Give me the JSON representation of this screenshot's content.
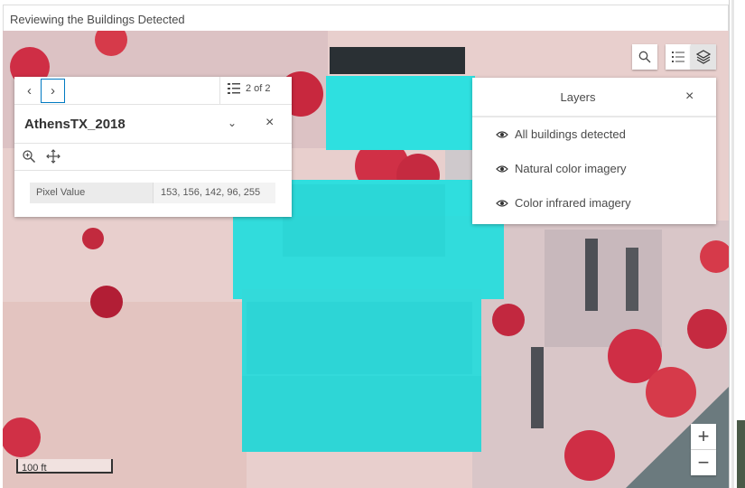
{
  "app": {
    "title": "Reviewing the Buildings Detected"
  },
  "popup": {
    "pagination": "2 of 2",
    "title": "AthensTX_2018",
    "fields": [
      {
        "label": "Pixel Value",
        "value": "153, 156, 142, 96, 255"
      }
    ],
    "icons": [
      "chevron-left-icon",
      "chevron-right-icon",
      "list-icon",
      "chevron-down-icon",
      "close-icon",
      "zoom-to-icon",
      "move-icon"
    ]
  },
  "toolbar": {
    "icons": [
      "search-icon",
      "legend-icon",
      "layers-icon"
    ]
  },
  "layers": {
    "title": "Layers",
    "items": [
      {
        "label": "All buildings detected",
        "visible": true
      },
      {
        "label": "Natural color imagery",
        "visible": true
      },
      {
        "label": "Color infrared imagery",
        "visible": true
      }
    ]
  },
  "map": {
    "scale_label": "100 ft",
    "detection_color": "#2ee0e0",
    "accent_color": "#007ac2",
    "vegetation_color": "#d63a4a"
  }
}
